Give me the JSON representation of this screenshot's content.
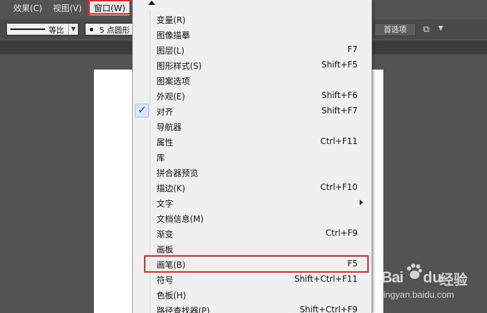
{
  "menubar": {
    "items": [
      "效果(C)",
      "视图(V)",
      "窗口(W)"
    ]
  },
  "toolbar": {
    "stroke_profile": "等比",
    "brush": "5 点圆形",
    "preferences_label": "首选项"
  },
  "window_menu": {
    "items": [
      {
        "label": "变量(R)",
        "shortcut": ""
      },
      {
        "label": "图像描摹",
        "shortcut": ""
      },
      {
        "label": "图层(L)",
        "shortcut": "F7"
      },
      {
        "label": "图形样式(S)",
        "shortcut": "Shift+F5"
      },
      {
        "label": "图案选项",
        "shortcut": ""
      },
      {
        "label": "外观(E)",
        "shortcut": "Shift+F6"
      },
      {
        "label": "对齐",
        "shortcut": "Shift+F7",
        "checked": true
      },
      {
        "label": "导航器",
        "shortcut": ""
      },
      {
        "label": "属性",
        "shortcut": "Ctrl+F11"
      },
      {
        "label": "库",
        "shortcut": ""
      },
      {
        "label": "拼合器预览",
        "shortcut": ""
      },
      {
        "label": "描边(K)",
        "shortcut": "Ctrl+F10"
      },
      {
        "label": "文字",
        "shortcut": "",
        "submenu": true
      },
      {
        "label": "文档信息(M)",
        "shortcut": ""
      },
      {
        "label": "渐变",
        "shortcut": "Ctrl+F9"
      },
      {
        "label": "画板",
        "shortcut": ""
      },
      {
        "label": "画笔(B)",
        "shortcut": "F5"
      },
      {
        "label": "符号",
        "shortcut": "Shift+Ctrl+F11"
      },
      {
        "label": "色板(H)",
        "shortcut": ""
      },
      {
        "label": "路径查找器(P)",
        "shortcut": "Shift+Ctrl+F9"
      }
    ]
  },
  "watermark": {
    "brand_bai": "Bai",
    "brand_du": "du",
    "brand_jingyan": "经验",
    "url": "jingyan.baidu.com"
  },
  "colors": {
    "highlight": "#e0242b",
    "check": "#1a3e8c"
  }
}
